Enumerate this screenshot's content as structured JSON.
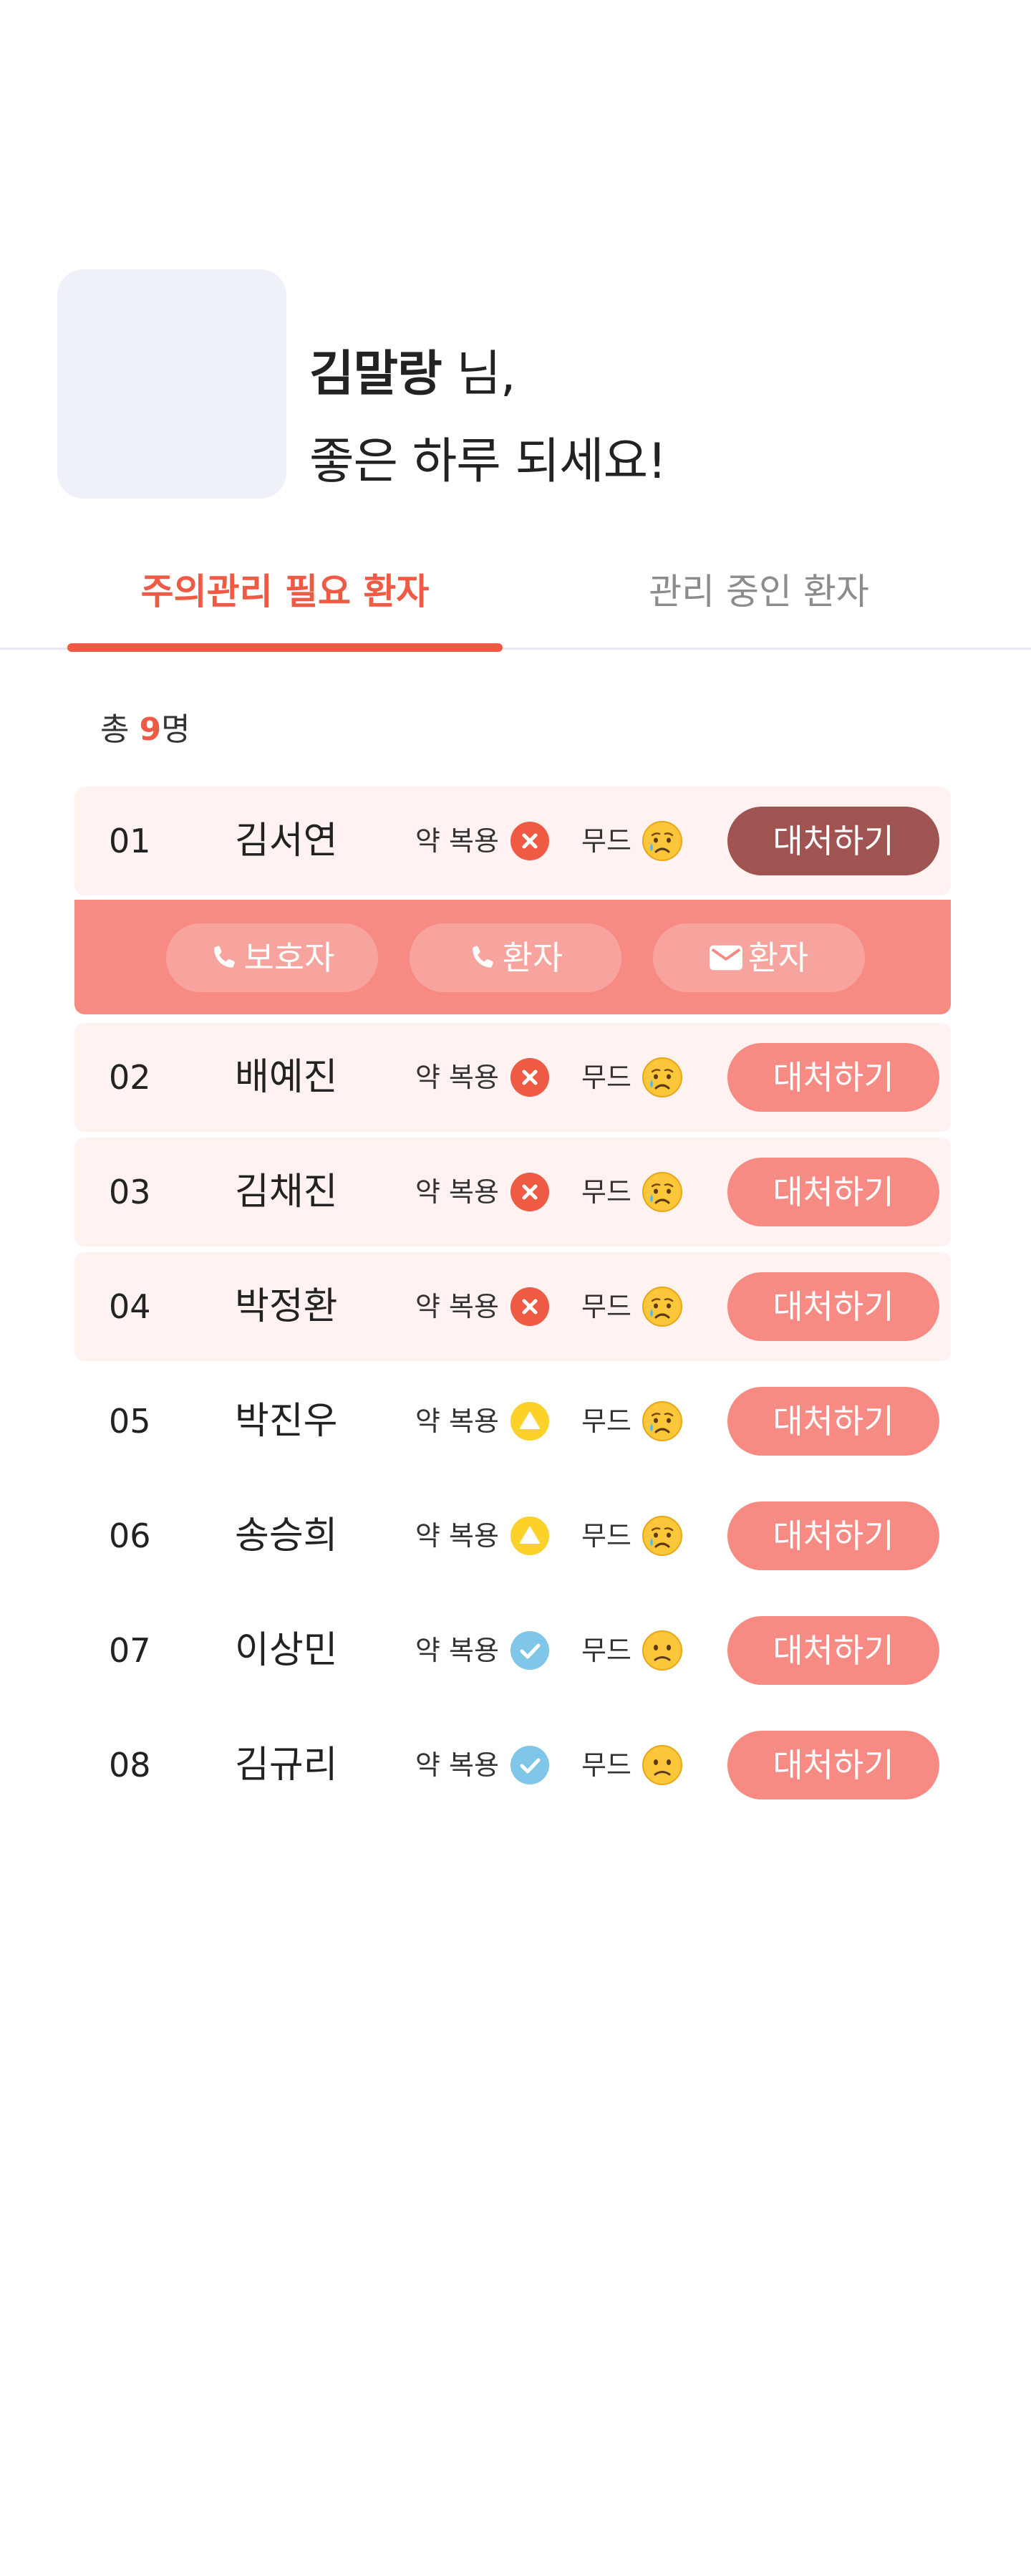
{
  "greeting": {
    "name": "김말랑",
    "suffix": "님,",
    "line2": "좋은 하루 되세요!"
  },
  "tabs": [
    {
      "label": "주의관리 필요 환자",
      "active": true
    },
    {
      "label": "관리 중인 환자",
      "active": false
    }
  ],
  "summary": {
    "prefix": "총 ",
    "count": "9",
    "unit": "명"
  },
  "column_labels": {
    "medication": "약 복용",
    "mood": "무드"
  },
  "action_label": "대처하기",
  "contact_actions": [
    {
      "label": "보호자",
      "icon": "phone-icon"
    },
    {
      "label": "환자",
      "icon": "phone-icon"
    },
    {
      "label": "환자",
      "icon": "mail-icon"
    }
  ],
  "patients": [
    {
      "index": "01",
      "name": "김서연",
      "medication": "missed",
      "mood": "crying",
      "alert": true,
      "expanded": true
    },
    {
      "index": "02",
      "name": "배예진",
      "medication": "missed",
      "mood": "crying",
      "alert": true
    },
    {
      "index": "03",
      "name": "김채진",
      "medication": "missed",
      "mood": "crying",
      "alert": true
    },
    {
      "index": "04",
      "name": "박정환",
      "medication": "missed",
      "mood": "crying",
      "alert": true
    },
    {
      "index": "05",
      "name": "박진우",
      "medication": "warning",
      "mood": "crying",
      "alert": false
    },
    {
      "index": "06",
      "name": "송승희",
      "medication": "warning",
      "mood": "crying",
      "alert": false
    },
    {
      "index": "07",
      "name": "이상민",
      "medication": "taken",
      "mood": "slightly-frowning",
      "alert": false
    },
    {
      "index": "08",
      "name": "김규리",
      "medication": "taken",
      "mood": "slightly-frowning",
      "alert": false
    }
  ],
  "colors": {
    "accent": "#ee5a43",
    "button": "#f78b83",
    "button_active": "#a05451",
    "alert_row_bg": "#fff2f1",
    "missed": "#ee5a43",
    "warning": "#fcd12a",
    "taken": "#7fc6e8"
  }
}
